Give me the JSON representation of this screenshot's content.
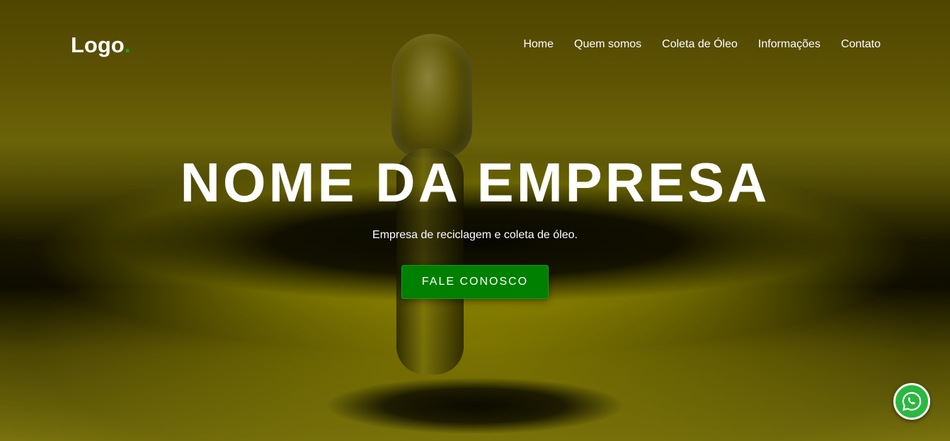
{
  "header": {
    "logo_text": "Logo",
    "logo_dot": ".",
    "nav": [
      {
        "label": "Home"
      },
      {
        "label": "Quem somos"
      },
      {
        "label": "Coleta de Óleo"
      },
      {
        "label": "Informações"
      },
      {
        "label": "Contato"
      }
    ]
  },
  "hero": {
    "title": "NOME DA EMPRESA",
    "subtitle": "Empresa de reciclagem e coleta de óleo.",
    "cta_label": "FALE CONOSCO"
  },
  "floating": {
    "whatsapp_icon": "whatsapp-icon"
  },
  "colors": {
    "accent_green": "#008000",
    "logo_dot": "#1f9f2a",
    "whatsapp_green": "#2bb741",
    "text": "#ffffff"
  }
}
